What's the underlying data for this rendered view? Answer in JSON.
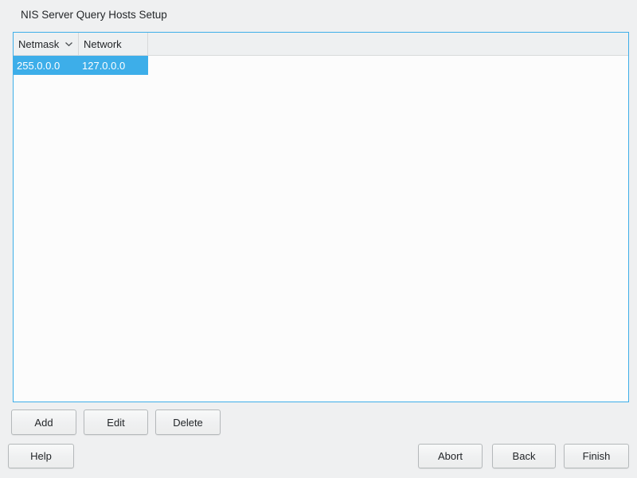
{
  "window": {
    "title": "NIS Server Query Hosts Setup"
  },
  "table": {
    "columns": [
      {
        "label": "Netmask",
        "sort_indicator": "chevron-down-icon"
      },
      {
        "label": "Network",
        "sort_indicator": null
      }
    ],
    "rows": [
      {
        "netmask": "255.0.0.0",
        "network": "127.0.0.0",
        "selected": true
      }
    ]
  },
  "actions": {
    "add": "Add",
    "edit": "Edit",
    "delete": "Delete"
  },
  "footer": {
    "help": "Help",
    "abort": "Abort",
    "back": "Back",
    "finish": "Finish"
  },
  "colors": {
    "selection": "#3daee9",
    "focus_border": "#3daee9",
    "window_background": "#eff0f1",
    "view_background": "#fcfcfc",
    "header_background": "#eef0f1",
    "text": "#232629",
    "selected_text": "#ffffff",
    "button_border": "#b4b8ba"
  }
}
